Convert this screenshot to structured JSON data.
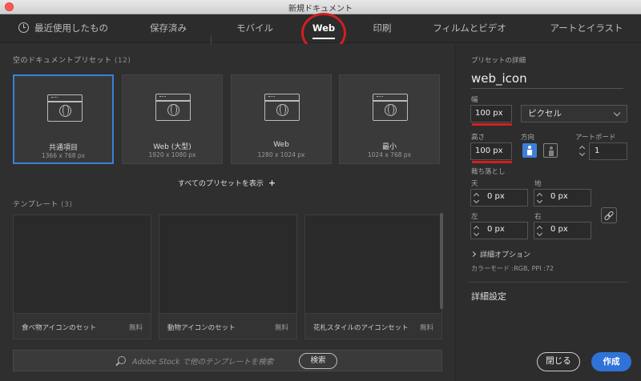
{
  "window": {
    "title": "新規ドキュメント"
  },
  "tabs": [
    {
      "label": "最近使用したもの"
    },
    {
      "label": "保存済み"
    },
    {
      "label": "モバイル"
    },
    {
      "label": "Web"
    },
    {
      "label": "印刷"
    },
    {
      "label": "フィルムとビデオ"
    },
    {
      "label": "アートとイラスト"
    }
  ],
  "presets_section": {
    "title": "空のドキュメントプリセット",
    "count": "(12)"
  },
  "presets": [
    {
      "name": "共通項目",
      "dims": "1366 x 768 px"
    },
    {
      "name": "Web (大型)",
      "dims": "1920 x 1080 px"
    },
    {
      "name": "Web",
      "dims": "1280 x 1024 px"
    },
    {
      "name": "最小",
      "dims": "1024 x 768 px"
    }
  ],
  "show_all": "すべてのプリセットを表示",
  "templates_section": {
    "title": "テンプレート",
    "count": "(3)"
  },
  "templates": [
    {
      "name": "食べ物アイコンのセット",
      "price": "無料"
    },
    {
      "name": "動物アイコンのセット",
      "price": "無料"
    },
    {
      "name": "花札スタイルのアイコンセット",
      "price": "無料"
    }
  ],
  "stock": {
    "placeholder": "Adobe Stock で他のテンプレートを検索",
    "button": "検索"
  },
  "details": {
    "title": "プリセットの詳細",
    "doc_name": "web_icon",
    "width_label": "幅",
    "width_value": "100 px",
    "unit": "ピクセル",
    "height_label": "高さ",
    "height_value": "100 px",
    "orientation_label": "方向",
    "artboard_label": "アートボード",
    "artboard_value": "1",
    "bleed_label": "裁ち落とし",
    "bleed_top_label": "天",
    "bleed_bottom_label": "地",
    "bleed_left_label": "左",
    "bleed_right_label": "右",
    "bleed_top": "0 px",
    "bleed_bottom": "0 px",
    "bleed_left": "0 px",
    "bleed_right": "0 px",
    "advanced_options": "詳細オプション",
    "color_mode": "カラーモード :RGB, PPI :72",
    "more_settings": "詳細設定"
  },
  "footer": {
    "close": "閉じる",
    "create": "作成"
  },
  "colors": {
    "accent": "#2f73d8",
    "annotation_red": "#d21f1f"
  }
}
